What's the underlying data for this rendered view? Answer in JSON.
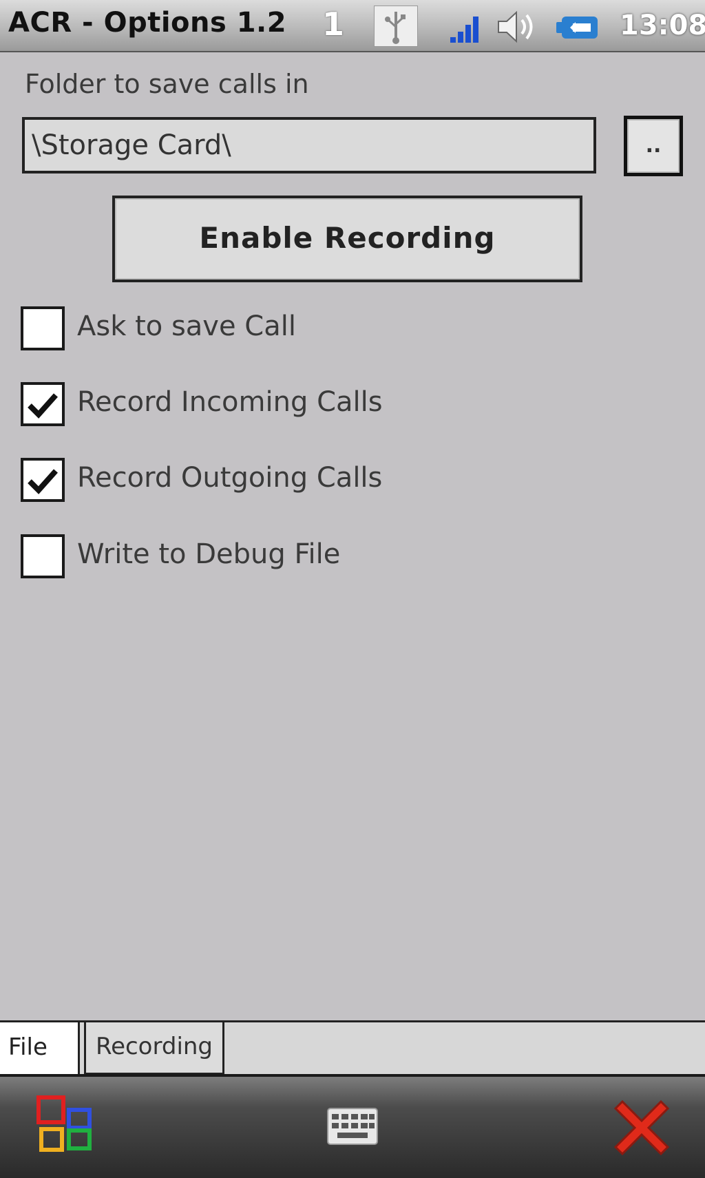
{
  "status_bar": {
    "app_title": "ACR - Options 1.2",
    "session_number": "1",
    "time": "13:08",
    "icons": [
      "usb-icon",
      "signal-icon",
      "volume-icon",
      "battery-icon"
    ]
  },
  "folder": {
    "label": "Folder to save calls in",
    "value": "\\Storage Card\\",
    "browse_label": ".."
  },
  "enable_button_label": "Enable Recording",
  "checkboxes": [
    {
      "label": "Ask to save Call",
      "checked": false
    },
    {
      "label": "Record Incoming Calls",
      "checked": true
    },
    {
      "label": "Record Outgoing Calls",
      "checked": true
    },
    {
      "label": "Write to Debug File",
      "checked": false
    }
  ],
  "tabs": [
    {
      "label": "File",
      "active": true
    },
    {
      "label": "Recording",
      "active": false
    }
  ],
  "bottom_bar": {
    "icons": [
      "start-icon",
      "keyboard-icon",
      "close-icon"
    ]
  },
  "colors": {
    "background": "#c4c2c5",
    "close_red": "#e02a1a",
    "signal_blue": "#1a4fd0",
    "battery_blue": "#2a7fd0"
  }
}
